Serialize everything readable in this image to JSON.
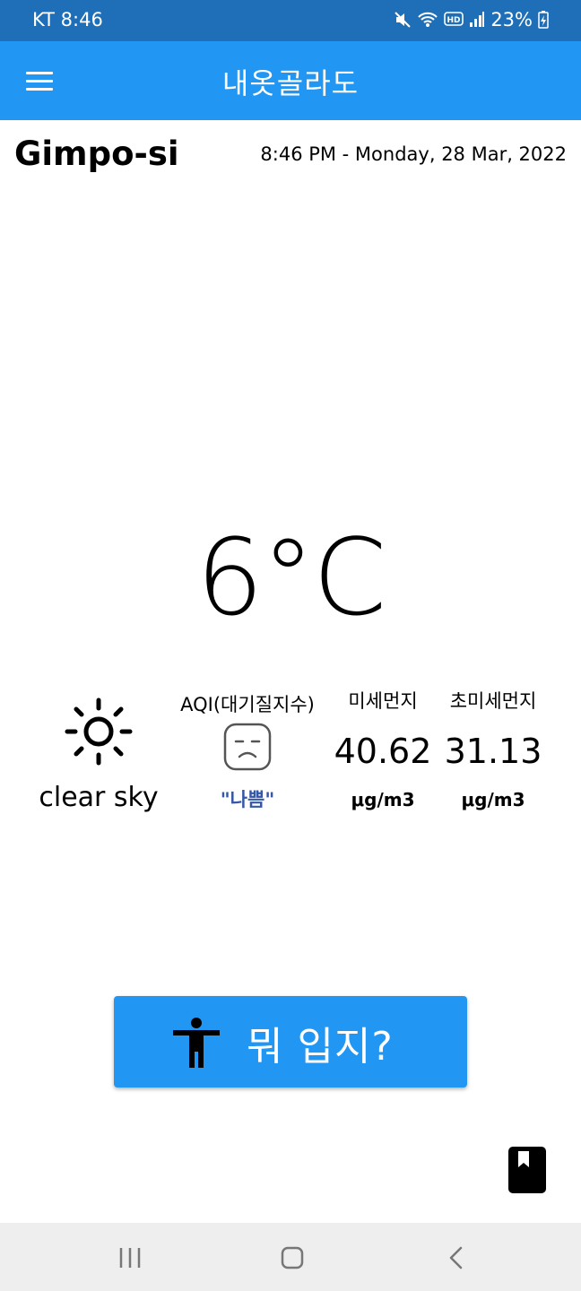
{
  "status_bar": {
    "carrier_time": "KT 8:46",
    "battery": "23%",
    "icons": [
      "mute-icon",
      "wifi-icon",
      "hd-icon",
      "signal-icon",
      "battery-charging-icon"
    ]
  },
  "app_bar": {
    "title": "내옷골라도",
    "menu_icon": "menu-icon",
    "background": "#2196f3"
  },
  "location": {
    "city": "Gimpo-si",
    "datetime": "8:46 PM - Monday, 28 Mar, 2022"
  },
  "weather": {
    "temperature": "6°C",
    "icon": "sun-icon",
    "description": "clear sky"
  },
  "aqi": {
    "label": "AQI(대기질지수)",
    "icon": "sad-face-icon",
    "status": "\"나쁨\"",
    "status_color": "#3557a5"
  },
  "pm10": {
    "label": "미세먼지",
    "value": "40.62",
    "unit": "μg/m3"
  },
  "pm25": {
    "label": "초미세먼지",
    "value": "31.13",
    "unit": "μg/m3"
  },
  "action_button": {
    "label": "뭐 입지?",
    "icon": "person-icon"
  },
  "book_button": {
    "icon": "book-icon"
  },
  "nav_bar": {
    "buttons": [
      "recents-icon",
      "home-icon",
      "back-icon"
    ]
  }
}
